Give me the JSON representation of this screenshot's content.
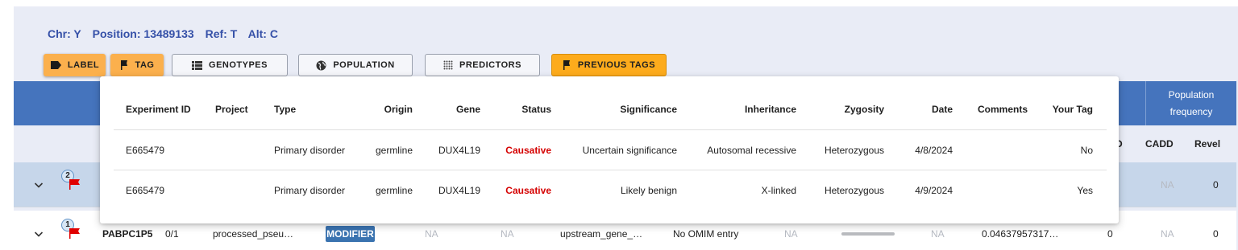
{
  "variant_info": {
    "chr": "Chr: Y",
    "position": "Position: 13489133",
    "ref": "Ref: T",
    "alt": "Alt: C"
  },
  "toolbar": {
    "label": "LABEL",
    "tag": "TAG",
    "genotypes": "GENOTYPES",
    "population": "POPULATION",
    "predictors": "PREDICTORS",
    "previous_tags": "PREVIOUS TAGS"
  },
  "table": {
    "population_frequency": "Population frequency",
    "sub_headers": {
      "d": "D",
      "cadd": "CADD",
      "revel": "Revel"
    },
    "rows": [
      {
        "badge": "2",
        "cadd": "NA",
        "revel": "0"
      },
      {
        "badge": "1",
        "gene": "PABPC1P5",
        "genotype": "0/1",
        "biotype": "processed_pseu…",
        "impact": "MODIFIER",
        "na1": "NA",
        "na2": "NA",
        "consequence": "upstream_gene_…",
        "omim": "No OMIM entry",
        "na3": "NA",
        "na4": "NA",
        "freq": "0.04637957317…",
        "d": "0",
        "cadd": "NA",
        "revel": "0"
      }
    ]
  },
  "previous_tags_popup": {
    "headers": {
      "experiment_id": "Experiment ID",
      "project": "Project",
      "type": "Type",
      "origin": "Origin",
      "gene": "Gene",
      "status": "Status",
      "significance": "Significance",
      "inheritance": "Inheritance",
      "zygosity": "Zygosity",
      "date": "Date",
      "comments": "Comments",
      "your_tag": "Your Tag"
    },
    "rows": [
      {
        "experiment_id": "E665479",
        "project": "",
        "type": "Primary disorder",
        "origin": "germline",
        "gene": "DUX4L19",
        "status": "Causative",
        "significance": "Uncertain significance",
        "inheritance": "Autosomal recessive",
        "zygosity": "Heterozygous",
        "date": "4/8/2024",
        "comments": "",
        "your_tag": "No"
      },
      {
        "experiment_id": "E665479",
        "project": "",
        "type": "Primary disorder",
        "origin": "germline",
        "gene": "DUX4L19",
        "status": "Causative",
        "significance": "Likely benign",
        "inheritance": "X-linked",
        "zygosity": "Heterozygous",
        "date": "4/9/2024",
        "comments": "",
        "your_tag": "Yes"
      }
    ]
  },
  "colors": {
    "header_blue": "#4574bd",
    "accent_orange": "#fbb04d",
    "previous_tags_orange": "#fdab1c",
    "causative_red": "#d50000",
    "info_text_blue": "#3651a8",
    "selected_row": "#c6d6ea",
    "flag_red": "#e00000"
  },
  "icons": {
    "label": "label-icon",
    "tag": "flag-icon",
    "genotypes": "list-icon",
    "population": "globe-icon",
    "predictors": "grid-dots-icon",
    "previous_tags": "flag-icon",
    "expand": "chevron-down-icon"
  }
}
